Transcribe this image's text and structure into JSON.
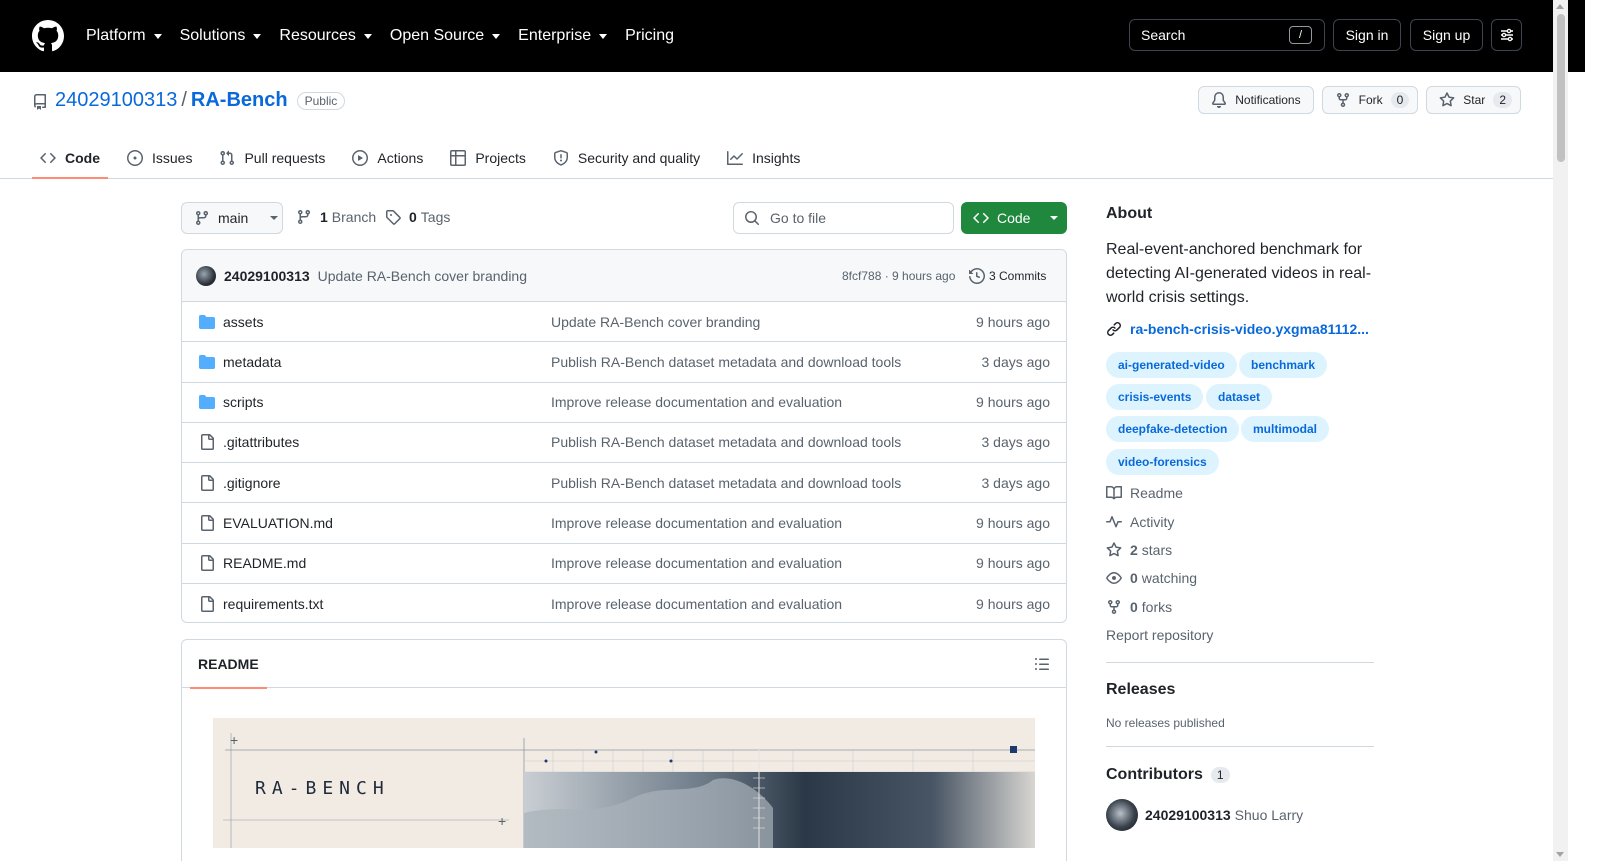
{
  "nav": {
    "items": [
      "Platform",
      "Solutions",
      "Resources",
      "Open Source",
      "Enterprise",
      "Pricing"
    ],
    "dropdown_flags": [
      true,
      true,
      true,
      true,
      true,
      false
    ],
    "search_label": "Search",
    "search_key": "/",
    "signin": "Sign in",
    "signup": "Sign up"
  },
  "repo": {
    "owner": "24029100313",
    "separator": "/",
    "name": "RA-Bench",
    "visibility": "Public",
    "notifications": "Notifications",
    "fork_label": "Fork",
    "fork_count": "0",
    "star_label": "Star",
    "star_count": "2"
  },
  "tabs": [
    "Code",
    "Issues",
    "Pull requests",
    "Actions",
    "Projects",
    "Security and quality",
    "Insights"
  ],
  "toolbar": {
    "branch": "main",
    "branch_count": "1",
    "branch_label": "Branch",
    "tag_count": "0",
    "tag_label": "Tags",
    "goto_placeholder": "Go to file",
    "code_button": "Code"
  },
  "commit": {
    "author": "24029100313",
    "message": "Update RA-Bench cover branding",
    "hash_time": "8fcf788 · 9 hours ago",
    "commits": "3 Commits"
  },
  "files": [
    {
      "name": "assets",
      "type": "folder",
      "commit": "Update RA-Bench cover branding",
      "age": "9 hours ago"
    },
    {
      "name": "metadata",
      "type": "folder",
      "commit": "Publish RA-Bench dataset metadata and download tools",
      "age": "3 days ago"
    },
    {
      "name": "scripts",
      "type": "folder",
      "commit": "Improve release documentation and evaluation",
      "age": "9 hours ago"
    },
    {
      "name": ".gitattributes",
      "type": "file",
      "commit": "Publish RA-Bench dataset metadata and download tools",
      "age": "3 days ago"
    },
    {
      "name": ".gitignore",
      "type": "file",
      "commit": "Publish RA-Bench dataset metadata and download tools",
      "age": "3 days ago"
    },
    {
      "name": "EVALUATION.md",
      "type": "file",
      "commit": "Improve release documentation and evaluation",
      "age": "9 hours ago"
    },
    {
      "name": "README.md",
      "type": "file",
      "commit": "Improve release documentation and evaluation",
      "age": "9 hours ago"
    },
    {
      "name": "requirements.txt",
      "type": "file",
      "commit": "Improve release documentation and evaluation",
      "age": "9 hours ago"
    }
  ],
  "readme": {
    "tab": "README",
    "cover_title": "RA-BENCH"
  },
  "about": {
    "title": "About",
    "description": "Real-event-anchored benchmark for detecting AI-generated videos in real-world crisis settings.",
    "link": "ra-bench-crisis-video.yxgma81112...",
    "topics": [
      "ai-generated-video",
      "benchmark",
      "crisis-events",
      "dataset",
      "deepfake-detection",
      "multimodal",
      "video-forensics"
    ],
    "readme": "Readme",
    "activity": "Activity",
    "stars_count": "2",
    "stars_label": "stars",
    "watching_count": "0",
    "watching_label": "watching",
    "forks_count": "0",
    "forks_label": "forks",
    "report": "Report repository"
  },
  "releases": {
    "title": "Releases",
    "empty": "No releases published"
  },
  "contributors": {
    "title": "Contributors",
    "count": "1",
    "login": "24029100313",
    "name": "Shuo Larry"
  }
}
